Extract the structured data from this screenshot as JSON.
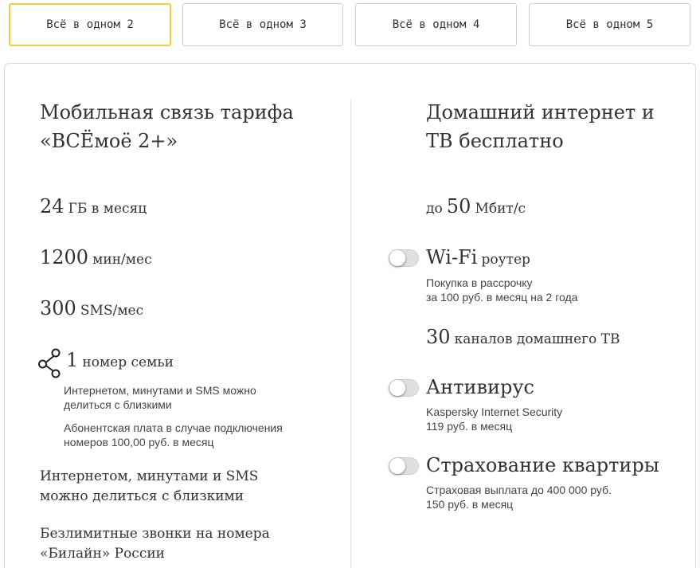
{
  "tabs": [
    {
      "label": "Всё в одном 2",
      "active": true
    },
    {
      "label": "Всё в одном 3",
      "active": false
    },
    {
      "label": "Всё в одном 4",
      "active": false
    },
    {
      "label": "Всё в одном 5",
      "active": false
    }
  ],
  "left": {
    "title_line1": "Мобильная связь тарифа",
    "title_line2": "«ВСЁмоё 2+»",
    "items": [
      {
        "value": "24",
        "unit": "ГБ в месяц"
      },
      {
        "value": "1200",
        "unit": "мин/мес"
      },
      {
        "value": "300",
        "unit": "SMS/мес"
      }
    ],
    "family": {
      "value": "1",
      "unit": "номер семьи",
      "icon": "share-icon",
      "note1_line1": "Интернетом, минутами и SMS можно",
      "note1_line2": "делиться с близкими",
      "note2_line1": "Абонентская плата в случае подключения",
      "note2_line2": "номеров 100,00 руб. в месяц"
    },
    "feature1_line1": "Интернетом, минутами и SMS",
    "feature1_line2": "можно делиться с близкими",
    "feature2_line1": "Безлимитные звонки на номера",
    "feature2_line2": "«Билайн» России"
  },
  "right": {
    "title_line1": "Домашний интернет и",
    "title_line2": "ТВ бесплатно",
    "speed": {
      "prefix": "до",
      "value": "50",
      "unit": "Мбит/с"
    },
    "wifi": {
      "title": "Wi-Fi",
      "suffix": "роутер",
      "line1": "Покупка в рассрочку",
      "line2": "за 100 руб. в месяц на 2 года",
      "enabled": false
    },
    "tv": {
      "value": "30",
      "unit": "каналов домашнего ТВ"
    },
    "antivirus": {
      "title": "Антивирус",
      "line1": "Kaspersky Internet Security",
      "line2": "119 руб. в месяц",
      "enabled": false
    },
    "insurance": {
      "title": "Страхование квартиры",
      "line1": "Страховая выплата до 400 000 руб.",
      "line2": "150 руб. в месяц",
      "enabled": false
    }
  },
  "colors": {
    "accent": "#f5cc35",
    "text": "#333333",
    "border": "#d9d9d9",
    "toggle_off": "#e0e0e0"
  }
}
